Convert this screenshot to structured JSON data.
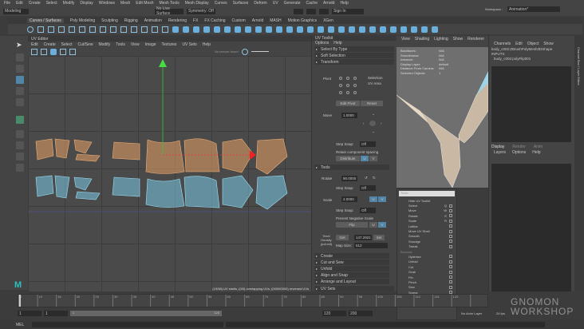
{
  "menubar": [
    "File",
    "Edit",
    "Create",
    "Select",
    "Modify",
    "Display",
    "Windows",
    "Mesh",
    "Edit Mesh",
    "Mesh Tools",
    "Mesh Display",
    "Curves",
    "Surfaces",
    "Deform",
    "UV",
    "Generate",
    "Cache",
    "Arnold",
    "Help"
  ],
  "status": {
    "mode": "Modeling",
    "live_surface": "No Live Surface",
    "symmetry": "Symmetry: Off",
    "sign_in": "Sign In",
    "workspace_label": "Workspace :",
    "workspace": "Animation*"
  },
  "shelf_tabs": [
    "Curves / Surfaces",
    "Poly Modeling",
    "Sculpting",
    "Rigging",
    "Animation",
    "Rendering",
    "FX",
    "FX Caching",
    "Custom",
    "Arnold",
    "MASH",
    "Motion Graphics",
    "XGen"
  ],
  "uv_editor": {
    "title": "UV Editor",
    "menu": [
      "Edit",
      "Create",
      "Select",
      "Cut/Sew",
      "Modify",
      "Tools",
      "View",
      "Image",
      "Textures",
      "UV Sets",
      "Help"
    ],
    "texture_status": "No texture found",
    "info": "(19/38) UV shells, (0/0) overlapping UVs, (0000/0000) reversed UVs"
  },
  "uv_toolkit": {
    "title": "UV Toolkit",
    "menu": [
      "Options",
      "Help"
    ],
    "sections_top": [
      "Select By Type",
      "Soft Selection"
    ],
    "transform": "Transform",
    "pivot": "Pivot",
    "pivot_opts": [
      "Selection",
      "UV Area"
    ],
    "edit_pivot": "Edit Pivot",
    "reset": "Reset",
    "move": "Move",
    "move_val": "1.0000",
    "step_snap": "Step Snap:",
    "off": "Off",
    "retain": "Retain component spacing",
    "distribute": "Distribute",
    "u": "U",
    "v": "V",
    "tools": "Tools",
    "rotate": "Rotate",
    "rotate_val": "90.0000",
    "scale": "Scale",
    "scale_val": "2.0000",
    "prevent_neg": "Prevent Negative Scale",
    "flip": "Flip",
    "texel": "Texel Density (px/unit)",
    "get": "Get",
    "texel_val": "147.2921",
    "set": "Set",
    "map_size_label": "Map Size:",
    "map_size": "512",
    "sections_bottom": [
      "Create",
      "Cut and Sew",
      "Unfold",
      "Align and Snap",
      "Arrange and Layout"
    ],
    "uv_sets": "UV Sets"
  },
  "viewport": {
    "menu": [
      "View",
      "Shading",
      "Lighting",
      "Show",
      "Renderer",
      "Panels"
    ],
    "hud": [
      [
        "Backfaces:",
        "N/A"
      ],
      [
        "Smoothness:",
        "N/A"
      ],
      [
        "Instance:",
        "N/A"
      ],
      [
        "Display Layer:",
        "default"
      ],
      [
        "Distance From Camera:",
        "N/A"
      ],
      [
        "Selected Objects:",
        "1"
      ]
    ]
  },
  "channel_box": {
    "menu": [
      "Channels",
      "Edit",
      "Object",
      "Show"
    ],
    "shape": "body_c002:ZBrushPolyMesh3DShape",
    "inputs": "INPUTS",
    "input_node": "body_c002:polyFlip001",
    "side_label": "Channel Box / Layer Editor",
    "layer_tabs": [
      "Display",
      "Render",
      "Anim"
    ],
    "layer_menu": [
      "Layers",
      "Options",
      "Help"
    ]
  },
  "tools_popup": {
    "search": "Tools",
    "hide": "Hide UV Toolkit",
    "items": [
      [
        "Select",
        "Q"
      ],
      [
        "Move",
        "W"
      ],
      [
        "Rotate",
        "E"
      ],
      [
        "Scale",
        "R"
      ],
      [
        "Lattice",
        ""
      ],
      [
        "Move UV Shell",
        ""
      ],
      [
        "Smooth",
        ""
      ],
      [
        "Smudge",
        ""
      ],
      [
        "Tweak",
        ""
      ]
    ],
    "brushes_label": "Brushes",
    "brushes": [
      "Optimize",
      "Unfold"
    ],
    "items2": [
      "Cut",
      "Grab",
      "Pin",
      "Pinch",
      "Sew",
      "Smear",
      "Symmetrize"
    ]
  },
  "timeline": {
    "ticks": [
      "5",
      "10",
      "15",
      "20",
      "25",
      "30",
      "35",
      "40",
      "45",
      "50",
      "55",
      "60",
      "65",
      "70",
      "75",
      "80",
      "85",
      "90",
      "95",
      "100",
      "105",
      "110",
      "115",
      "120"
    ],
    "current": "1"
  },
  "range": {
    "start": "1",
    "start2": "1",
    "slider_start": "1",
    "slider_end": "120",
    "end": "120",
    "end2": "200",
    "anim_layer": "No Anim Layer",
    "fps": "24 fps"
  },
  "cmd": {
    "label": "MEL"
  },
  "watermark": "THE GNOMON WORKSHOP"
}
